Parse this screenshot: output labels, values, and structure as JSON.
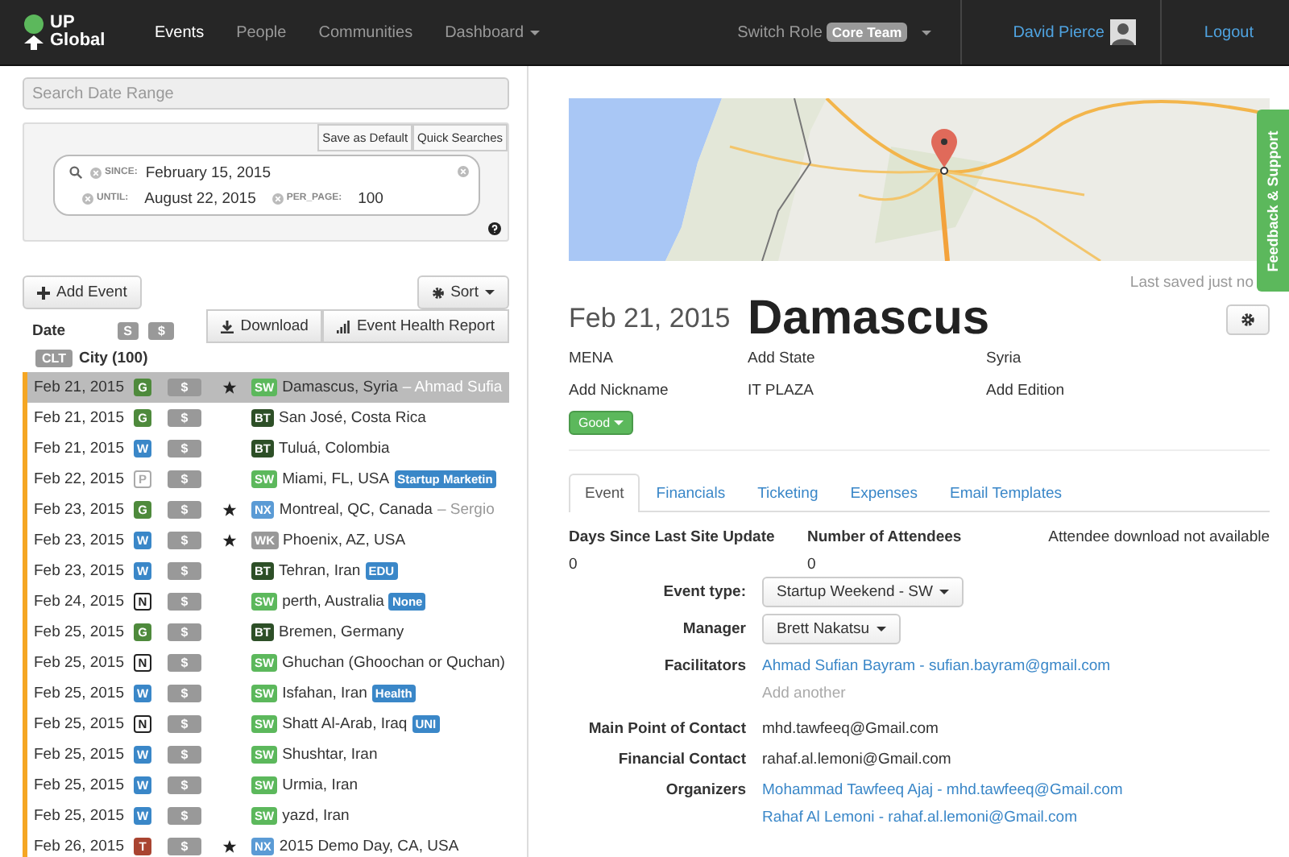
{
  "navbar": {
    "logo_top": "UP",
    "logo_bottom": "Global",
    "items": [
      {
        "label": "Events",
        "selected": true,
        "dropdown": false
      },
      {
        "label": "People",
        "selected": false,
        "dropdown": false
      },
      {
        "label": "Communities",
        "selected": false,
        "dropdown": false
      },
      {
        "label": "Dashboard",
        "selected": false,
        "dropdown": true
      }
    ],
    "switch_role": "Switch Role",
    "role": "Core Team",
    "user": "David Pierce",
    "logout": "Logout"
  },
  "sidebar": {
    "search": {
      "placeholder": "Search Date Range"
    },
    "save_default": "Save as Default",
    "quick_searches": "Quick Searches",
    "filters": [
      {
        "key": "SINCE:",
        "value": "February 15, 2015"
      },
      {
        "key": "UNTIL:",
        "value": "August 22, 2015"
      },
      {
        "key": "PER_PAGE:",
        "value": "100"
      }
    ],
    "add_event": "Add Event",
    "sort": "Sort",
    "download": "Download",
    "health_report": "Event Health Report",
    "header": {
      "date": "Date",
      "badge_1": "S",
      "badge_2": "$",
      "clt": "CLT",
      "city": "City (100)"
    },
    "rows": [
      {
        "date": "Feb 21, 2015",
        "type": {
          "letter": "G",
          "kind": "filled",
          "color": "#4e8a3c"
        },
        "fee": "$",
        "starred": true,
        "program": {
          "code": "SW",
          "color": "#5cb85c"
        },
        "city": "Damascus, Syria",
        "suffix": "– Ahmad Sufia",
        "selected": true
      },
      {
        "date": "Feb 21, 2015",
        "type": {
          "letter": "G",
          "kind": "filled",
          "color": "#4e8a3c"
        },
        "fee": "$",
        "starred": false,
        "program": {
          "code": "BT",
          "color": "#2d4f27"
        },
        "city": "San José, Costa Rica",
        "selected": false
      },
      {
        "date": "Feb 21, 2015",
        "type": {
          "letter": "W",
          "kind": "filled",
          "color": "#3a87c8"
        },
        "fee": "$",
        "starred": false,
        "program": {
          "code": "BT",
          "color": "#2d4f27"
        },
        "city": "Tuluá, Colombia",
        "selected": false
      },
      {
        "date": "Feb 22, 2015",
        "type": {
          "letter": "P",
          "kind": "outline",
          "color": "#aaaaaa"
        },
        "fee": "$",
        "starred": false,
        "program": {
          "code": "SW",
          "color": "#5cb85c"
        },
        "city": "Miami, FL, USA",
        "tag": "Startup Marketin",
        "selected": false
      },
      {
        "date": "Feb 23, 2015",
        "type": {
          "letter": "G",
          "kind": "filled",
          "color": "#4e8a3c"
        },
        "fee": "$",
        "starred": true,
        "program": {
          "code": "NX",
          "color": "#5b9bd5"
        },
        "city": "Montreal, QC, Canada",
        "suffix": "– Sergio",
        "selected": false
      },
      {
        "date": "Feb 23, 2015",
        "type": {
          "letter": "W",
          "kind": "filled",
          "color": "#3a87c8"
        },
        "fee": "$",
        "starred": true,
        "program": {
          "code": "WK",
          "color": "#999999"
        },
        "city": "Phoenix, AZ, USA",
        "selected": false
      },
      {
        "date": "Feb 23, 2015",
        "type": {
          "letter": "W",
          "kind": "filled",
          "color": "#3a87c8"
        },
        "fee": "$",
        "starred": false,
        "program": {
          "code": "BT",
          "color": "#2d4f27"
        },
        "city": "Tehran, Iran",
        "tag": "EDU",
        "selected": false
      },
      {
        "date": "Feb 24, 2015",
        "type": {
          "letter": "N",
          "kind": "outline",
          "color": "#222222"
        },
        "fee": "$",
        "starred": false,
        "program": {
          "code": "SW",
          "color": "#5cb85c"
        },
        "city": "perth, Australia",
        "tag": "None",
        "selected": false
      },
      {
        "date": "Feb 25, 2015",
        "type": {
          "letter": "G",
          "kind": "filled",
          "color": "#4e8a3c"
        },
        "fee": "$",
        "starred": false,
        "program": {
          "code": "BT",
          "color": "#2d4f27"
        },
        "city": "Bremen, Germany",
        "selected": false
      },
      {
        "date": "Feb 25, 2015",
        "type": {
          "letter": "N",
          "kind": "outline",
          "color": "#222222"
        },
        "fee": "$",
        "starred": false,
        "program": {
          "code": "SW",
          "color": "#5cb85c"
        },
        "city": "Ghuchan (Ghoochan or Quchan)",
        "selected": false
      },
      {
        "date": "Feb 25, 2015",
        "type": {
          "letter": "W",
          "kind": "filled",
          "color": "#3a87c8"
        },
        "fee": "$",
        "starred": false,
        "program": {
          "code": "SW",
          "color": "#5cb85c"
        },
        "city": "Isfahan, Iran",
        "tag": "Health",
        "selected": false
      },
      {
        "date": "Feb 25, 2015",
        "type": {
          "letter": "N",
          "kind": "outline",
          "color": "#222222"
        },
        "fee": "$",
        "starred": false,
        "program": {
          "code": "SW",
          "color": "#5cb85c"
        },
        "city": "Shatt Al-Arab, Iraq",
        "tag": "UNI",
        "selected": false
      },
      {
        "date": "Feb 25, 2015",
        "type": {
          "letter": "W",
          "kind": "filled",
          "color": "#3a87c8"
        },
        "fee": "$",
        "starred": false,
        "program": {
          "code": "SW",
          "color": "#5cb85c"
        },
        "city": "Shushtar, Iran",
        "selected": false
      },
      {
        "date": "Feb 25, 2015",
        "type": {
          "letter": "W",
          "kind": "filled",
          "color": "#3a87c8"
        },
        "fee": "$",
        "starred": false,
        "program": {
          "code": "SW",
          "color": "#5cb85c"
        },
        "city": "Urmia, Iran",
        "selected": false
      },
      {
        "date": "Feb 25, 2015",
        "type": {
          "letter": "W",
          "kind": "filled",
          "color": "#3a87c8"
        },
        "fee": "$",
        "starred": false,
        "program": {
          "code": "SW",
          "color": "#5cb85c"
        },
        "city": "yazd, Iran",
        "selected": false
      },
      {
        "date": "Feb 26, 2015",
        "type": {
          "letter": "T",
          "kind": "filled",
          "color": "#a94431"
        },
        "fee": "$",
        "starred": true,
        "program": {
          "code": "NX",
          "color": "#5b9bd5"
        },
        "city": "2015 Demo Day, CA, USA",
        "selected": false
      }
    ]
  },
  "detail": {
    "last_saved": "Last saved just no",
    "date": "Feb 21, 2015",
    "title": "Damascus",
    "info": [
      "MENA",
      "Add State",
      "Syria",
      "Add Nickname",
      "IT PLAZA",
      "Add Edition"
    ],
    "status": "Good",
    "tabs": [
      {
        "label": "Event",
        "selected": true
      },
      {
        "label": "Financials",
        "selected": false
      },
      {
        "label": "Ticketing",
        "selected": false
      },
      {
        "label": "Expenses",
        "selected": false
      },
      {
        "label": "Email Templates",
        "selected": false
      }
    ],
    "stats": [
      {
        "label": "Days Since Last Site Update",
        "value": "0"
      },
      {
        "label": "Number of Attendees",
        "value": "0"
      }
    ],
    "attendee_note": "Attendee download not available",
    "fields": [
      {
        "label": "Event type:",
        "kind": "dropdown",
        "values": [
          "Startup Weekend - SW"
        ]
      },
      {
        "label": "Manager",
        "kind": "dropdown",
        "values": [
          "Brett Nakatsu"
        ]
      },
      {
        "label": "Facilitators",
        "kind": "links",
        "values": [
          "Ahmad Sufian Bayram - sufian.bayram@gmail.com"
        ],
        "add": "Add another"
      },
      {
        "label": "Main Point of Contact",
        "kind": "text",
        "values": [
          "mhd.tawfeeq@Gmail.com"
        ]
      },
      {
        "label": "Financial Contact",
        "kind": "text",
        "values": [
          "rahaf.al.lemoni@Gmail.com"
        ]
      },
      {
        "label": "Organizers",
        "kind": "links",
        "values": [
          "Mohammad Tawfeeq Ajaj - mhd.tawfeeq@Gmail.com",
          "Rahaf Al Lemoni - rahaf.al.lemoni@Gmail.com"
        ]
      }
    ]
  },
  "feedback_tab": "Feedback & Support"
}
